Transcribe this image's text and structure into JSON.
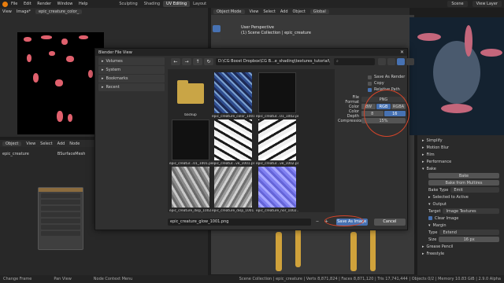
{
  "topbar": {
    "menu": [
      "File",
      "Edit",
      "Render",
      "Window",
      "Help"
    ],
    "tabs": [
      "Sculpting",
      "Shading",
      "UV Editing",
      "Layout"
    ],
    "active_tab": "UV Editing",
    "scene": "Scene",
    "view_layer": "View Layer"
  },
  "uv_editor": {
    "view": "View",
    "image_menu": "Image*",
    "image_name": "epic_creature_color_"
  },
  "viewport": {
    "mode": "Object Mode",
    "menus": [
      "View",
      "Select",
      "Add",
      "Object"
    ],
    "orientation": "Global",
    "info_line1": "User Perspective",
    "info_line2": "(1) Scene Collection | epic_creature"
  },
  "node_editor": {
    "mode": "Object",
    "menus": [
      "View",
      "Select",
      "Add",
      "Node"
    ],
    "object": "epic_creature",
    "modifier": "BSurfaceMesh"
  },
  "properties": {
    "panels": [
      "Simplify",
      "Motion Blur",
      "Film",
      "Performance",
      "Bake"
    ],
    "bake_button": "Bake",
    "bake_from_multires": "Bake from Multires",
    "bake_type_label": "Bake Type",
    "bake_type_value": "Emit",
    "selected_to_active": "Selected to Active",
    "output_label": "Output",
    "target_label": "Target",
    "target_value": "Image Textures",
    "clear_image": "Clear Image",
    "margin_label": "Margin",
    "type_label": "Type",
    "type_value": "Extend",
    "size_label": "Size",
    "size_value": "16 px",
    "grease_pencil": "Grease Pencil",
    "freestyle": "Freestyle"
  },
  "dialog": {
    "title": "Blender File View",
    "sidebar": [
      "Volumes",
      "System",
      "Bookmarks",
      "Recent"
    ],
    "path": "D:\\CG Boost Dropbox\\CG B...e_shading\\textures_tutorial\\",
    "files": [
      {
        "label": "backup",
        "kind": "folder"
      },
      {
        "label": "epic_creature_color_1001.png",
        "kind": "color"
      },
      {
        "label": "epic_creatur...01_1002.png",
        "kind": "dark"
      },
      {
        "label": "epic_creatur...01_1001.png",
        "kind": "dark"
      },
      {
        "label": "epic_creatur...ve_1001.png",
        "kind": "mask"
      },
      {
        "label": "epic_creatur...ve_1002.png",
        "kind": "mask"
      },
      {
        "label": "epic_creature_disp_1002...",
        "kind": "disp"
      },
      {
        "label": "epic_creature_disp_1001...",
        "kind": "disp"
      },
      {
        "label": "epic_creature_nor_1002...",
        "kind": "normal"
      }
    ],
    "options": {
      "save_as_render": "Save As Render",
      "copy": "Copy",
      "relative_path": "Relative Path",
      "file_format_label": "File Format",
      "file_format_value": "PNG",
      "color_label": "Color",
      "color_options": [
        "BW",
        "RGB",
        "RGBA"
      ],
      "color_active": "RGB",
      "depth_label": "Color Depth",
      "depth_options": [
        "8",
        "16"
      ],
      "depth_active": "16",
      "compression_label": "Compression",
      "compression_value": "15%"
    },
    "filename": "epic_creature_glow_1001.png",
    "save_button": "Save As Image",
    "cancel_button": "Cancel"
  },
  "statusbar": {
    "left1": "Change Frame",
    "left2": "Pan View",
    "left3": "Node Context Menu",
    "right": "Scene Collection | epic_creature | Verts 8,871,824 | Faces 8,871,120 | Tris 17,741,444 | Objects 0/2 | Memory 10.83 GiB | 2.9.0 Alpha"
  },
  "colors": {
    "accent": "#4772b3",
    "annotation": "#d6452a",
    "uv_islands": "#e0606d"
  }
}
